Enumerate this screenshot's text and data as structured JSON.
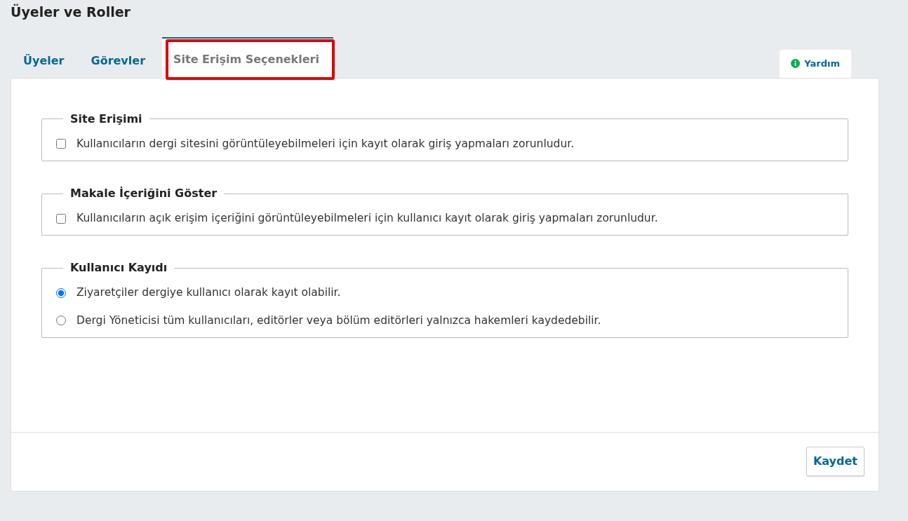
{
  "page_title": "Üyeler ve Roller",
  "tabs": [
    {
      "label": "Üyeler",
      "selected": false,
      "highlighted": false
    },
    {
      "label": "Görevler",
      "selected": false,
      "highlighted": false
    },
    {
      "label": "Site Erişim Seçenekleri",
      "selected": true,
      "highlighted": true
    }
  ],
  "help": {
    "label": "Yardım"
  },
  "sections": [
    {
      "legend": "Site Erişimi",
      "options": [
        {
          "kind": "checkbox",
          "label": "Kullanıcıların dergi sitesini görüntüleyebilmeleri için kayıt olarak giriş yapmaları zorunludur.",
          "checked": false
        }
      ]
    },
    {
      "legend": "Makale İçeriğini Göster",
      "options": [
        {
          "kind": "checkbox",
          "label": "Kullanıcıların açık erişim içeriğini görüntüleyebilmeleri için kullanıcı kayıt olarak giriş yapmaları zorunludur.",
          "checked": false
        }
      ]
    },
    {
      "legend": "Kullanıcı Kayıdı",
      "options": [
        {
          "kind": "radio",
          "label": "Ziyaretçiler dergiye kullanıcı olarak kayıt olabilir.",
          "checked": true
        },
        {
          "kind": "radio",
          "label": "Dergi Yöneticisi tüm kullanıcıları, editörler veya bölüm editörleri yalnızca hakemleri kaydedebilir.",
          "checked": false
        }
      ]
    }
  ],
  "save_button": "Kaydet"
}
